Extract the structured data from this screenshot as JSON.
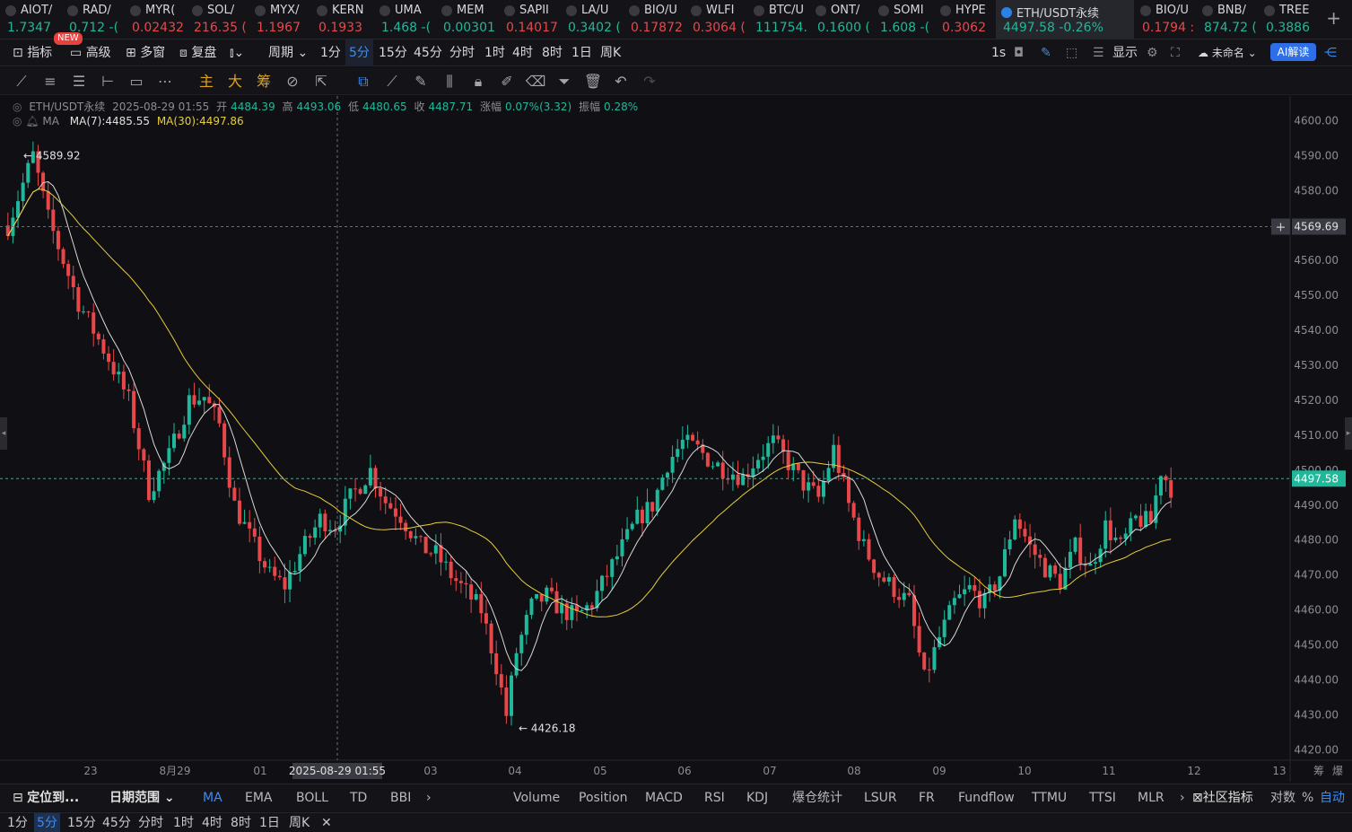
{
  "tickers": [
    {
      "name": "AIOT/",
      "price": "1.7347",
      "color": "#1fb89a"
    },
    {
      "name": "RAD/",
      "price": "0.712 -(",
      "color": "#1fb89a"
    },
    {
      "name": "MYR(",
      "price": "0.02432",
      "color": "#e8474a"
    },
    {
      "name": "SOL/",
      "price": "216.35 (",
      "color": "#e8474a"
    },
    {
      "name": "MYX/",
      "price": "1.1967",
      "color": "#e8474a"
    },
    {
      "name": "KERN",
      "price": "0.1933",
      "color": "#e8474a"
    },
    {
      "name": "UMA",
      "price": "1.468 -(",
      "color": "#1fb89a"
    },
    {
      "name": "MEM",
      "price": "0.00301",
      "color": "#1fb89a"
    },
    {
      "name": "SAPII",
      "price": "0.14017",
      "color": "#e8474a"
    },
    {
      "name": "LA/U",
      "price": "0.3402 (",
      "color": "#1fb89a"
    },
    {
      "name": "BIO/U",
      "price": "0.17872",
      "color": "#e8474a"
    },
    {
      "name": "WLFI",
      "price": "0.3064 (",
      "color": "#e8474a"
    },
    {
      "name": "BTC/U",
      "price": "111754.",
      "color": "#1fb89a"
    },
    {
      "name": "ONT/",
      "price": "0.1600 (",
      "color": "#1fb89a"
    },
    {
      "name": "SOMI",
      "price": "1.608 -(",
      "color": "#1fb89a"
    },
    {
      "name": "HYPE",
      "price": "0.3062",
      "color": "#e8474a"
    },
    {
      "name": "ETH/USDT永续",
      "price": "4497.58  -0.26%",
      "color": "#1fb89a"
    },
    {
      "name": "BIO/U",
      "price": "0.1794 :",
      "color": "#e8474a"
    },
    {
      "name": "BNB/",
      "price": "874.72 (",
      "color": "#1fb89a"
    },
    {
      "name": "TREE",
      "price": "0.3886",
      "color": "#1fb89a"
    }
  ],
  "toolbar": {
    "indicators": "指标",
    "advanced": "高级",
    "new_badge": "NEW",
    "multiwin": "多窗",
    "replay": "复盘",
    "period": "周期",
    "periods": [
      "1分",
      "5分",
      "15分",
      "45分",
      "分时",
      "1时",
      "4时",
      "8时",
      "1日",
      "周K"
    ],
    "right": {
      "interval": "1s",
      "display": "显示",
      "unnamed": "未命名",
      "ai": "AI解读"
    }
  },
  "drawtools": {
    "labels": [
      "主",
      "大",
      "筹"
    ]
  },
  "info": {
    "symbol": "ETH/USDT永续",
    "time": "2025-08-29 01:55",
    "open_label": "开",
    "open": "4484.39",
    "high_label": "高",
    "high": "4493.06",
    "low_label": "低",
    "low": "4480.65",
    "close_label": "收",
    "close": "4487.71",
    "chg_label": "涨幅",
    "chg": "0.07%(3.32)",
    "amp_label": "振幅",
    "amp": "0.28%",
    "ma_label": "MA",
    "ma7": "MA(7):4485.55",
    "ma30": "MA(30):4497.86"
  },
  "chart_data": {
    "type": "candlestick",
    "symbol": "ETH/USDT永续",
    "y_ticks": [
      "4600.00",
      "4590.00",
      "4580.00",
      "4570.00",
      "4560.00",
      "4550.00",
      "4540.00",
      "4530.00",
      "4520.00",
      "4510.00",
      "4500.00",
      "4490.00",
      "4480.00",
      "4470.00",
      "4460.00",
      "4450.00",
      "4440.00",
      "4430.00",
      "4420.00"
    ],
    "ylim": [
      4417,
      4605
    ],
    "x_ticks": [
      "23",
      "8月29",
      "01",
      "03",
      "04",
      "05",
      "06",
      "07",
      "08",
      "09",
      "10",
      "11",
      "12",
      "13"
    ],
    "crosshair_time": "2025-08-29 01:55",
    "crosshair_price": "4569.69",
    "last_price": "4497.58",
    "high_marker": "4589.92",
    "low_marker": "4426.18",
    "colors": {
      "up": "#1fb89a",
      "down": "#e8474a",
      "ma7": "#d9d9d9",
      "ma30": "#e6cd3a"
    },
    "kpath": [
      [
        0,
        4570
      ],
      [
        5,
        4590
      ],
      [
        8,
        4572
      ],
      [
        14,
        4548
      ],
      [
        20,
        4532
      ],
      [
        24,
        4520
      ],
      [
        28,
        4494
      ],
      [
        32,
        4504
      ],
      [
        36,
        4520
      ],
      [
        39,
        4521
      ],
      [
        42,
        4513
      ],
      [
        45,
        4490
      ],
      [
        48,
        4481
      ],
      [
        52,
        4470
      ],
      [
        55,
        4467
      ],
      [
        58,
        4476
      ],
      [
        62,
        4486
      ],
      [
        65,
        4484
      ],
      [
        68,
        4492
      ],
      [
        72,
        4500
      ],
      [
        75,
        4491
      ],
      [
        78,
        4487
      ],
      [
        82,
        4478
      ],
      [
        85,
        4476
      ],
      [
        88,
        4470
      ],
      [
        91,
        4465
      ],
      [
        94,
        4460
      ],
      [
        97,
        4444
      ],
      [
        99,
        4430
      ],
      [
        101,
        4448
      ],
      [
        104,
        4461
      ],
      [
        107,
        4464
      ],
      [
        110,
        4460
      ],
      [
        113,
        4458
      ],
      [
        116,
        4462
      ],
      [
        119,
        4470
      ],
      [
        122,
        4478
      ],
      [
        125,
        4486
      ],
      [
        128,
        4490
      ],
      [
        131,
        4502
      ],
      [
        134,
        4508
      ],
      [
        137,
        4506
      ],
      [
        140,
        4502
      ],
      [
        143,
        4500
      ],
      [
        146,
        4498
      ],
      [
        149,
        4504
      ],
      [
        152,
        4508
      ],
      [
        155,
        4502
      ],
      [
        158,
        4496
      ],
      [
        161,
        4492
      ],
      [
        164,
        4506
      ],
      [
        167,
        4490
      ],
      [
        170,
        4478
      ],
      [
        173,
        4470
      ],
      [
        176,
        4466
      ],
      [
        179,
        4462
      ],
      [
        182,
        4440
      ],
      [
        185,
        4452
      ],
      [
        188,
        4462
      ],
      [
        191,
        4466
      ],
      [
        194,
        4462
      ],
      [
        197,
        4470
      ],
      [
        200,
        4487
      ],
      [
        203,
        4478
      ],
      [
        206,
        4472
      ],
      [
        209,
        4468
      ],
      [
        212,
        4478
      ],
      [
        215,
        4472
      ],
      [
        218,
        4484
      ],
      [
        221,
        4478
      ],
      [
        224,
        4486
      ],
      [
        227,
        4485
      ],
      [
        229,
        4500
      ],
      [
        231,
        4495
      ]
    ]
  },
  "bottom": {
    "locate": "定位到...",
    "date_range": "日期范围",
    "main_inds": [
      "MA",
      "EMA",
      "BOLL",
      "TD",
      "BBI"
    ],
    "sub_inds": [
      "Volume",
      "Position",
      "MACD",
      "RSI",
      "KDJ",
      "爆仓统计",
      "LSUR",
      "FR",
      "Fundflow",
      "TTMU",
      "TTSI",
      "MLR"
    ],
    "community": "社区指标",
    "log": "对数",
    "pct": "%",
    "auto": "自动",
    "periods": [
      "1分",
      "5分",
      "15分",
      "45分",
      "分时",
      "1时",
      "4时",
      "8时",
      "1日",
      "周K"
    ],
    "close": "✕",
    "corner1": "筹",
    "corner2": "爆"
  }
}
